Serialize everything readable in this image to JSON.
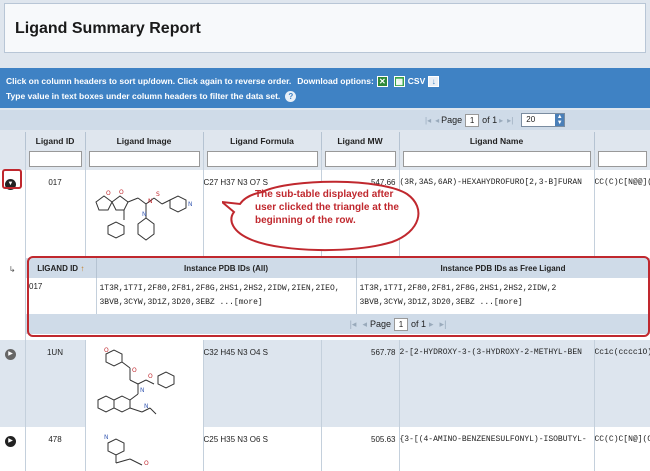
{
  "page": {
    "title": "Ligand Summary Report"
  },
  "instructions": {
    "line1": "Click on column headers to sort up/down. Click again to reverse order.",
    "download_label": "Download options:",
    "csv_label": "CSV",
    "line2": "Type value in text boxes under column headers to filter the data set."
  },
  "pager": {
    "page_label": "Page",
    "page_value": "1",
    "of_label": "of 1",
    "rows_per_page": "20"
  },
  "columns": [
    "Ligand ID",
    "Ligand Image",
    "Ligand Formula",
    "Ligand MW",
    "Ligand Name",
    ""
  ],
  "rows": [
    {
      "id": "017",
      "formula": "C27 H37 N3 O7 S",
      "mw": "547.66",
      "name": "(3R,3AS,6AR)-HEXAHYDROFURO[2,3-B]FURAN",
      "smiles": "CC(C)C[N@@]("
    },
    {
      "id": "1UN",
      "formula": "C32 H45 N3 O4 S",
      "mw": "567.78",
      "name": "2-[2-HYDROXY-3-(3-HYDROXY-2-METHYL-BEN",
      "smiles": "Cc1c(cccc1O)("
    },
    {
      "id": "478",
      "formula": "C25 H35 N3 O6 S",
      "mw": "505.63",
      "name": "{3-[(4-AMINO-BENZENESULFONYL)-ISOBUTYL-",
      "smiles": "CC(C)C[N@](C"
    }
  ],
  "callout": {
    "text": "The sub-table displayed after user clicked the triangle at the beginning of the row."
  },
  "subtable": {
    "headers": [
      "LIGAND ID",
      "Instance PDB IDs (All)",
      "Instance PDB IDs as Free Ligand"
    ],
    "sort_icon": "↑",
    "row": {
      "id": "017",
      "all_line1": "1T3R,1T7I,2F80,2F81,2F8G,2HS1,2HS2,2IDW,2IEN,2IEO,",
      "all_line2": "3BVB,3CYW,3D1Z,3D20,3EBZ ...[more]",
      "free_line1": "1T3R,1T7I,2F80,2F81,2F8G,2HS1,2HS2,2IDW,2",
      "free_line2": "3BVB,3CYW,3D1Z,3D20,3EBZ ...[more]"
    },
    "pager": {
      "page_label": "Page",
      "page_value": "1",
      "of_label": "of 1"
    }
  },
  "colors": {
    "accent": "#3f82c4",
    "callout": "#c0282e",
    "header_bg": "#dfe6ee"
  }
}
